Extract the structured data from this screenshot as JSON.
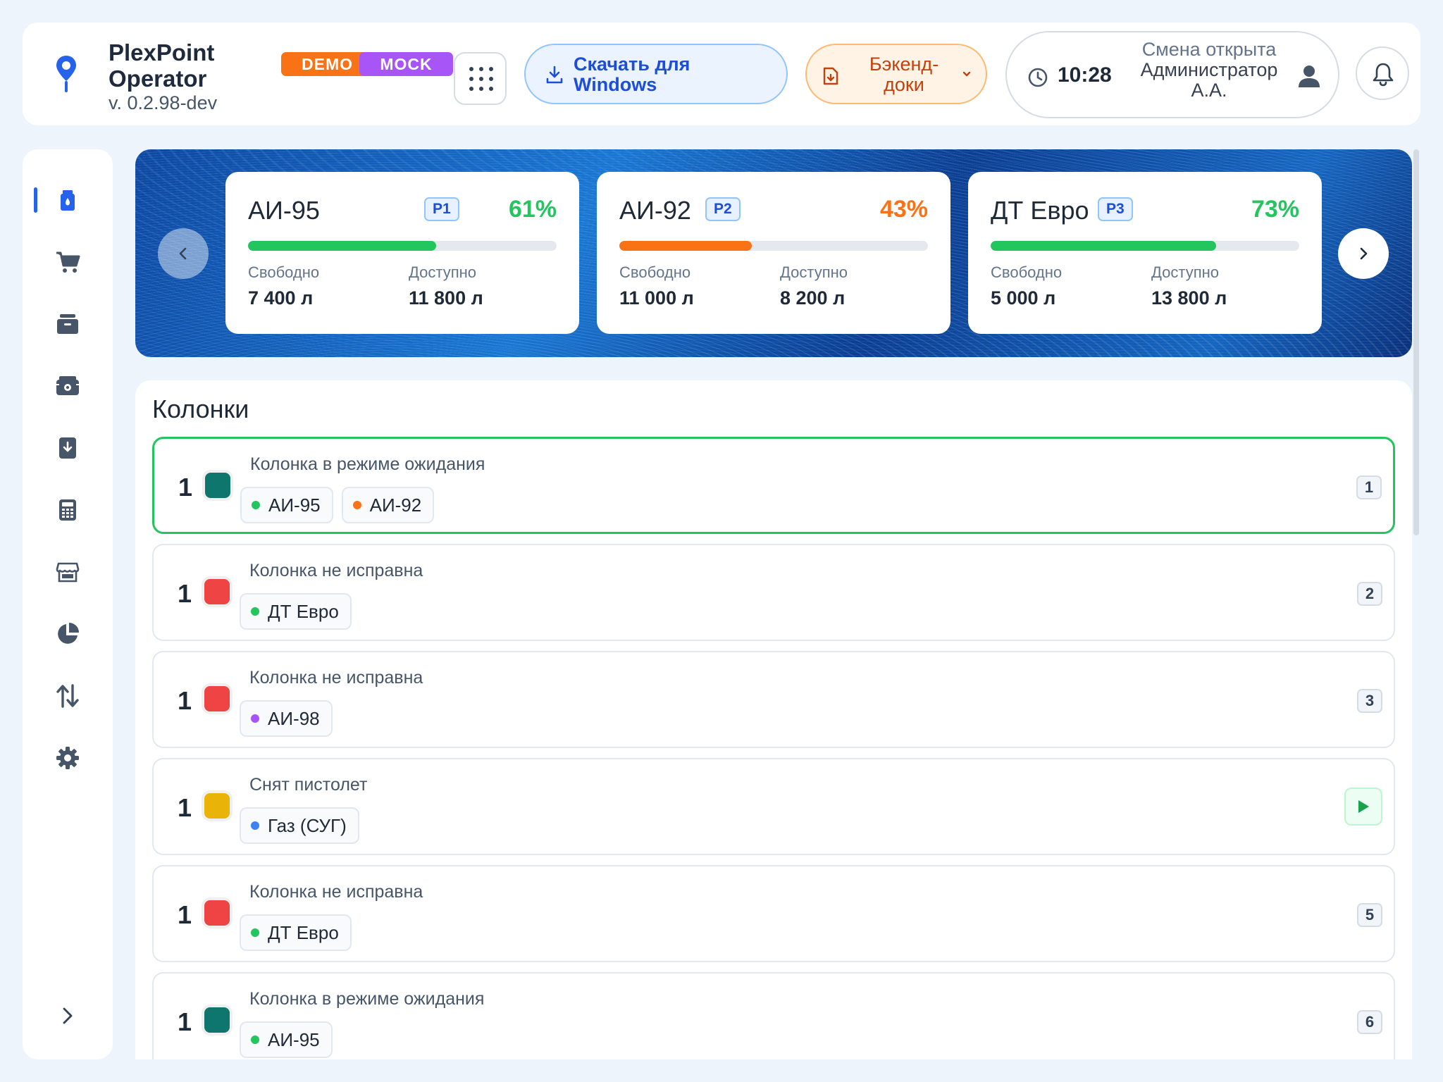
{
  "header": {
    "app_name": "PlexPoint Operator",
    "version": "v. 0.2.98-dev",
    "badge_demo": "DEMO",
    "badge_mock": "MOCK",
    "download_label": "Скачать для Windows",
    "backend_docs_label": "Бэкенд-доки",
    "time": "10:28",
    "shift_status": "Смена открыта",
    "user_name": "Администратор А.А."
  },
  "tanks": [
    {
      "name": "АИ-95",
      "code": "Р1",
      "percent_label": "61%",
      "level": 0.61,
      "color": "#22c55e",
      "free_label": "Свободно",
      "free_value": "7 400 л",
      "avail_label": "Доступно",
      "avail_value": "11 800 л"
    },
    {
      "name": "АИ-92",
      "code": "Р2",
      "percent_label": "43%",
      "level": 0.43,
      "color": "#f97316",
      "free_label": "Свободно",
      "free_value": "11 000 л",
      "avail_label": "Доступно",
      "avail_value": "8 200 л"
    },
    {
      "name": "ДТ Евро",
      "code": "Р3",
      "percent_label": "73%",
      "level": 0.73,
      "color": "#22c55e",
      "free_label": "Свободно",
      "free_value": "5 000 л",
      "avail_label": "Доступно",
      "avail_value": "13 800 л"
    }
  ],
  "pumps": {
    "title": "Колонки",
    "items": [
      {
        "num": "1",
        "status": "Колонка в режиме ожидания",
        "color": "#0f766e",
        "fuels": [
          {
            "name": "АИ-95",
            "dot": "#22c55e"
          },
          {
            "name": "АИ-92",
            "dot": "#f97316"
          }
        ],
        "badge": "1"
      },
      {
        "num": "1",
        "status": "Колонка не исправна",
        "color": "#ef4444",
        "fuels": [
          {
            "name": "ДТ Евро",
            "dot": "#22c55e"
          }
        ],
        "badge": "2"
      },
      {
        "num": "1",
        "status": "Колонка не исправна",
        "color": "#ef4444",
        "fuels": [
          {
            "name": "АИ-98",
            "dot": "#a855f7"
          }
        ],
        "badge": "3"
      },
      {
        "num": "1",
        "status": "Снят пистолет",
        "color": "#eab308",
        "fuels": [
          {
            "name": "Газ (СУГ)",
            "dot": "#3b82f6"
          }
        ],
        "badge": ""
      },
      {
        "num": "1",
        "status": "Колонка не исправна",
        "color": "#ef4444",
        "fuels": [
          {
            "name": "ДТ Евро",
            "dot": "#22c55e"
          }
        ],
        "badge": "5"
      },
      {
        "num": "1",
        "status": "Колонка в режиме ожидания",
        "color": "#0f766e",
        "fuels": [
          {
            "name": "АИ-95",
            "dot": "#22c55e"
          }
        ],
        "badge": "6"
      }
    ]
  },
  "sidebar": {
    "icons": [
      "fuel-icon",
      "cart-icon",
      "archive-icon",
      "cash-register-icon",
      "download-doc-icon",
      "calculator-icon",
      "store-icon",
      "pie-chart-icon",
      "transfer-icon",
      "settings-icon"
    ],
    "active_index": 0
  },
  "colors": {
    "accent": "#2563eb",
    "success": "#22c55e",
    "warning": "#f97316"
  }
}
